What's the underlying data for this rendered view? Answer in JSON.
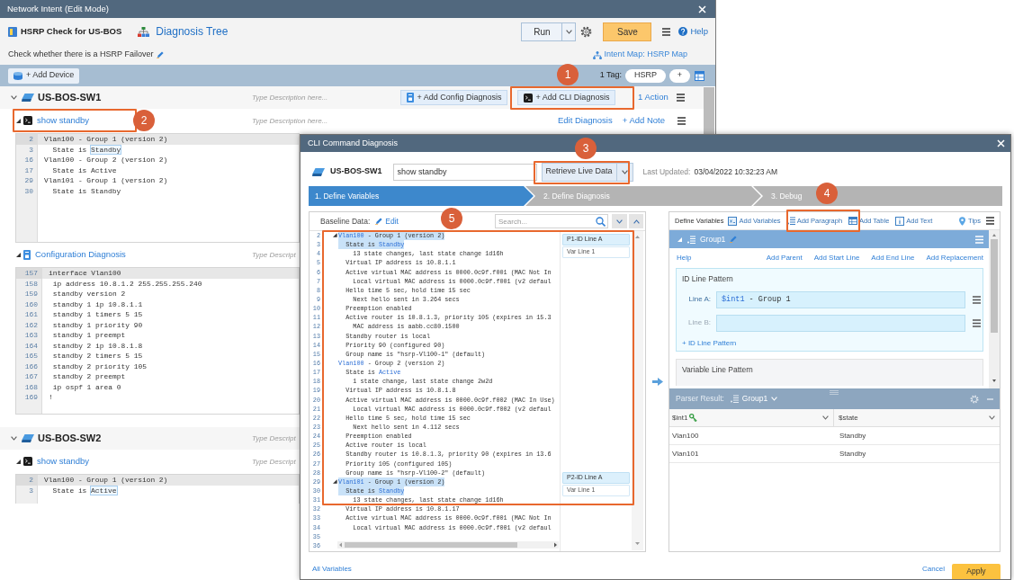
{
  "main_window": {
    "title": "Network Intent (Edit Mode)"
  },
  "intent": {
    "name": "HSRP Check for US-BOS",
    "tree_link": "Diagnosis Tree",
    "run": "Run",
    "save": "Save",
    "help": "Help",
    "description": "Check whether there is a HSRP Failover",
    "map_link": "Intent Map: HSRP Map"
  },
  "device_bar": {
    "add_device": "+ Add Device",
    "tag_label": "1 Tag:",
    "tags": [
      "HSRP"
    ],
    "add_tag": "+"
  },
  "devices": [
    {
      "name": "US-BOS-SW1",
      "expanded": true,
      "placeholder": "Type Description here...",
      "actions": [
        {
          "label": "+ Add Config Diagnosis",
          "kind": "config"
        },
        {
          "label": "+ Add CLI Diagnosis",
          "kind": "cli"
        }
      ],
      "action_count": "1 Action",
      "diagnoses": [
        {
          "kind": "cli",
          "name": "show standby",
          "expanded": true,
          "placeholder": "Type Description here...",
          "links": [
            "Edit Diagnosis",
            "+ Add Note"
          ],
          "lines": [
            {
              "number": "2",
              "text": "Vlan100 - Group 1 (version 2)",
              "current": true
            },
            {
              "number": "3",
              "segments": [
                {
                  "text": "  State is ",
                  "kind": "plain"
                },
                {
                  "text": "Standby",
                  "kind": "boxed"
                }
              ],
              "current": false
            },
            {
              "number": "16",
              "text": "Vlan100 - Group 2 (version 2)",
              "current": false
            },
            {
              "number": "17",
              "text": "  State is Active",
              "current": false
            },
            {
              "number": "29",
              "text": "Vlan101 - Group 1 (version 2)",
              "current": false
            },
            {
              "number": "30",
              "text": "  State is Standby",
              "current": false
            }
          ]
        },
        {
          "kind": "config",
          "name": "Configuration Diagnosis",
          "expanded": true,
          "placeholder": "Type Descript",
          "lines": [
            {
              "number": "157",
              "text": "interface Vlan100",
              "current": true
            },
            {
              "number": "158",
              "text": " ip address 10.8.1.2 255.255.255.240",
              "current": false
            },
            {
              "number": "159",
              "text": " standby version 2",
              "current": false
            },
            {
              "number": "160",
              "text": " standby 1 ip 10.8.1.1",
              "current": false
            },
            {
              "number": "161",
              "text": " standby 1 timers 5 15",
              "current": false
            },
            {
              "number": "162",
              "text": " standby 1 priority 90",
              "current": false
            },
            {
              "number": "163",
              "text": " standby 1 preempt",
              "current": false
            },
            {
              "number": "164",
              "text": " standby 2 ip 10.8.1.8",
              "current": false
            },
            {
              "number": "165",
              "text": " standby 2 timers 5 15",
              "current": false
            },
            {
              "number": "166",
              "text": " standby 2 priority 105",
              "current": false
            },
            {
              "number": "167",
              "text": " standby 2 preempt",
              "current": false
            },
            {
              "number": "168",
              "text": " ip ospf 1 area 0",
              "current": false
            },
            {
              "number": "169",
              "text": "!",
              "current": false
            }
          ]
        }
      ]
    },
    {
      "name": "US-BOS-SW2",
      "expanded": true,
      "placeholder": "Type Descript",
      "diagnoses": [
        {
          "kind": "cli",
          "name": "show standby",
          "expanded": true,
          "placeholder": "Type Descript",
          "lines": [
            {
              "number": "2",
              "text": "Vlan100 - Group 1 (version 2)",
              "current": true
            },
            {
              "number": "3",
              "segments": [
                {
                  "text": "  State is ",
                  "kind": "plain"
                },
                {
                  "text": "Active",
                  "kind": "boxed"
                }
              ],
              "current": false
            }
          ]
        }
      ]
    }
  ],
  "dialog": {
    "title": "CLI Command Diagnosis",
    "device": "US-BOS-SW1",
    "command": {
      "value": "show standby"
    },
    "retrieve": "Retrieve Live Data",
    "last_updated_label": "Last Updated:",
    "last_updated": "03/04/2022 10:32:23 AM",
    "steps": [
      {
        "label": "1. Define Variables",
        "selected": true
      },
      {
        "label": "2. Define Diagnosis",
        "selected": false
      },
      {
        "label": "3. Debug",
        "selected": false
      }
    ],
    "baseline": {
      "label": "Baseline Data:",
      "edit": "Edit",
      "search": {
        "placeholder": "Search..."
      },
      "lines": [
        {
          "number": "2",
          "fold": "◢",
          "segments": [
            {
              "text": "Vlan100",
              "kind": "variable"
            },
            {
              "text": " - Group 1 (version 2)",
              "kind": "plain"
            }
          ],
          "highlighted": true,
          "tag": {
            "label": "P1-ID Line A",
            "kind": "id"
          }
        },
        {
          "number": "3",
          "segments": [
            {
              "text": "  State is ",
              "kind": "plain"
            },
            {
              "text": "Standby",
              "kind": "variable"
            }
          ],
          "highlighted": true,
          "tag": {
            "label": "Var Line 1",
            "kind": "var"
          }
        },
        {
          "number": "4",
          "text": "    13 state changes, last state change 1d16h",
          "highlighted": false
        },
        {
          "number": "5",
          "text": "  Virtual IP address is 10.8.1.1",
          "highlighted": false
        },
        {
          "number": "6",
          "text": "  Active virtual MAC address is 0000.0c9f.f001 (MAC Not In",
          "highlighted": false
        },
        {
          "number": "7",
          "text": "    Local virtual MAC address is 0000.0c9f.f001 (v2 defaul",
          "highlighted": false
        },
        {
          "number": "8",
          "text": "  Hello time 5 sec, hold time 15 sec",
          "highlighted": false
        },
        {
          "number": "9",
          "text": "    Next hello sent in 3.264 secs",
          "highlighted": false
        },
        {
          "number": "10",
          "text": "  Preemption enabled",
          "highlighted": false
        },
        {
          "number": "11",
          "text": "  Active router is 10.8.1.3, priority 105 (expires in 15.3",
          "highlighted": false
        },
        {
          "number": "12",
          "text": "    MAC address is aabb.cc80.1500",
          "highlighted": false
        },
        {
          "number": "13",
          "text": "  Standby router is local",
          "highlighted": false
        },
        {
          "number": "14",
          "text": "  Priority 90 (configured 90)",
          "highlighted": false
        },
        {
          "number": "15",
          "text": "  Group name is \"hsrp-Vl100-1\" (default)",
          "highlighted": false
        },
        {
          "number": "16",
          "segments": [
            {
              "text": "Vlan100",
              "kind": "variable"
            },
            {
              "text": " - Group 2 (version 2)",
              "kind": "plain"
            }
          ],
          "highlighted": false
        },
        {
          "number": "17",
          "segments": [
            {
              "text": "  State is ",
              "kind": "plain"
            },
            {
              "text": "Active",
              "kind": "variable"
            }
          ],
          "highlighted": false
        },
        {
          "number": "18",
          "text": "    1 state change, last state change 2w2d",
          "highlighted": false
        },
        {
          "number": "19",
          "text": "  Virtual IP address is 10.8.1.8",
          "highlighted": false
        },
        {
          "number": "20",
          "text": "  Active virtual MAC address is 0000.0c9f.f002 (MAC In Use)",
          "highlighted": false
        },
        {
          "number": "21",
          "text": "    Local virtual MAC address is 0000.0c9f.f002 (v2 defaul",
          "highlighted": false
        },
        {
          "number": "22",
          "text": "  Hello time 5 sec, hold time 15 sec",
          "highlighted": false
        },
        {
          "number": "23",
          "text": "    Next hello sent in 4.112 secs",
          "highlighted": false
        },
        {
          "number": "24",
          "text": "  Preemption enabled",
          "highlighted": false
        },
        {
          "number": "25",
          "text": "  Active router is local",
          "highlighted": false
        },
        {
          "number": "26",
          "text": "  Standby router is 10.8.1.3, priority 90 (expires in 13.6",
          "highlighted": false
        },
        {
          "number": "27",
          "text": "  Priority 105 (configured 105)",
          "highlighted": false
        },
        {
          "number": "28",
          "text": "  Group name is \"hsrp-Vl100-2\" (default)",
          "highlighted": false
        },
        {
          "number": "29",
          "fold": "◢",
          "segments": [
            {
              "text": "Vlan101",
              "kind": "variable"
            },
            {
              "text": " - Group 1 (version 2)",
              "kind": "plain"
            }
          ],
          "highlighted": true,
          "tag": {
            "label": "P2-ID Line A",
            "kind": "id"
          }
        },
        {
          "number": "30",
          "segments": [
            {
              "text": "  State is ",
              "kind": "plain"
            },
            {
              "text": "Standby",
              "kind": "variable"
            }
          ],
          "highlighted": true,
          "tag": {
            "label": "Var Line 1",
            "kind": "var"
          }
        },
        {
          "number": "31",
          "text": "    13 state changes, last state change 1d16h",
          "highlighted": false
        },
        {
          "number": "32",
          "text": "  Virtual IP address is 10.8.1.17",
          "highlighted": false
        },
        {
          "number": "33",
          "text": "  Active virtual MAC address is 0000.0c9f.f001 (MAC Not In",
          "highlighted": false
        },
        {
          "number": "34",
          "text": "    Local virtual MAC address is 0000.0c9f.f001 (v2 defaul",
          "highlighted": false
        },
        {
          "number": "35",
          "highlighted": false
        },
        {
          "number": "36",
          "highlighted": false
        }
      ]
    },
    "variables": {
      "title": "Define Variables",
      "tools": [
        "Add Variables",
        "Add Paragraph",
        "Add Table",
        "Add Text"
      ],
      "tips": "Tips",
      "group": {
        "name": "Group1",
        "expanded": true
      },
      "help": "Help",
      "links": [
        "Add Parent",
        "Add Start Line",
        "Add End Line",
        "Add Replacement"
      ],
      "id_pattern": {
        "title": "ID Line Pattern",
        "lines": [
          {
            "label": "Line A:",
            "segments": [
              {
                "text": "$int1",
                "kind": "variable"
              },
              {
                "text": " - Group 1",
                "kind": "plain"
              }
            ],
            "disabled": false
          },
          {
            "label": "Line B:",
            "disabled": true
          }
        ],
        "add": "+ ID Line Pattern"
      },
      "var_pattern": {
        "title": "Variable Line Pattern"
      }
    },
    "parser": {
      "label": "Parser Result:",
      "group": "Group1",
      "columns": [
        {
          "label": "$int1",
          "key": true
        },
        {
          "label": "$state",
          "key": false
        }
      ],
      "rows": [
        {
          "cells": [
            "Vlan100",
            "Standby"
          ]
        },
        {
          "cells": [
            "Vlan101",
            "Standby"
          ]
        }
      ]
    },
    "footer": {
      "all_variables": "All Variables",
      "cancel": "Cancel",
      "apply": "Apply"
    }
  },
  "annotations": [
    {
      "number": "1"
    },
    {
      "number": "2"
    },
    {
      "number": "3"
    },
    {
      "number": "4"
    },
    {
      "number": "5"
    }
  ]
}
